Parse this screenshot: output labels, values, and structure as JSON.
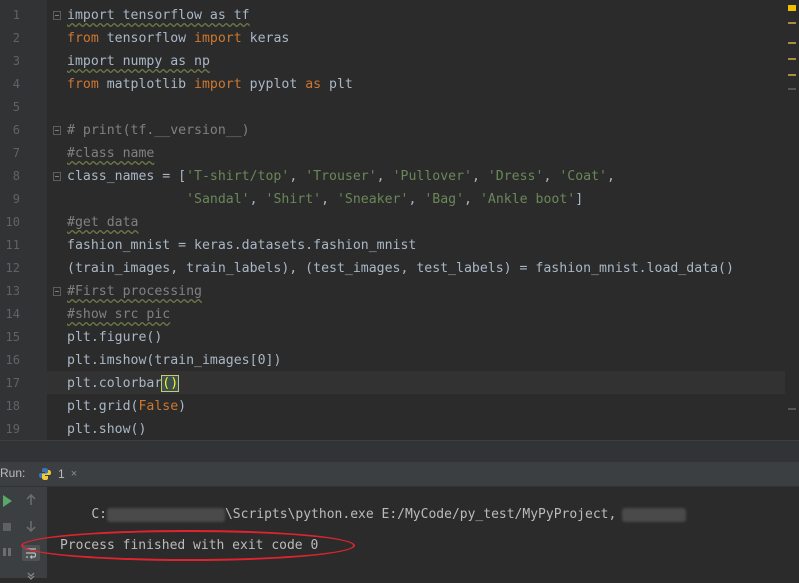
{
  "editor": {
    "line_numbers": [
      "1",
      "2",
      "3",
      "4",
      "5",
      "6",
      "7",
      "8",
      "9",
      "10",
      "11",
      "12",
      "13",
      "14",
      "15",
      "16",
      "17",
      "18",
      "19"
    ],
    "lines": [
      {
        "tokens": [
          {
            "t": "import tensorflow as tf",
            "c": "wavy"
          }
        ]
      },
      {
        "tokens": [
          {
            "t": "from",
            "c": "kw"
          },
          {
            "t": " tensorflow ",
            "c": ""
          },
          {
            "t": "import",
            "c": "kw"
          },
          {
            "t": " keras",
            "c": ""
          }
        ]
      },
      {
        "tokens": [
          {
            "t": "import numpy as np",
            "c": "wavy"
          }
        ]
      },
      {
        "tokens": [
          {
            "t": "from",
            "c": "kw"
          },
          {
            "t": " matplotlib ",
            "c": ""
          },
          {
            "t": "import",
            "c": "kw"
          },
          {
            "t": " pyplot ",
            "c": ""
          },
          {
            "t": "as",
            "c": "kw"
          },
          {
            "t": " plt",
            "c": ""
          }
        ]
      },
      {
        "tokens": []
      },
      {
        "tokens": [
          {
            "t": "# print(tf.__version__)",
            "c": "cm"
          }
        ]
      },
      {
        "tokens": [
          {
            "t": "#class name",
            "c": "cm wavy"
          }
        ]
      },
      {
        "tokens": [
          {
            "t": "class_names = [",
            "c": ""
          },
          {
            "t": "'T-shirt/top'",
            "c": "str"
          },
          {
            "t": ", ",
            "c": ""
          },
          {
            "t": "'Trouser'",
            "c": "str"
          },
          {
            "t": ", ",
            "c": ""
          },
          {
            "t": "'Pullover'",
            "c": "str"
          },
          {
            "t": ", ",
            "c": ""
          },
          {
            "t": "'Dress'",
            "c": "str"
          },
          {
            "t": ", ",
            "c": ""
          },
          {
            "t": "'Coat'",
            "c": "str"
          },
          {
            "t": ",",
            "c": ""
          }
        ]
      },
      {
        "tokens": [
          {
            "t": "               ",
            "c": ""
          },
          {
            "t": "'Sandal'",
            "c": "str"
          },
          {
            "t": ", ",
            "c": ""
          },
          {
            "t": "'Shirt'",
            "c": "str"
          },
          {
            "t": ", ",
            "c": ""
          },
          {
            "t": "'Sneaker'",
            "c": "str"
          },
          {
            "t": ", ",
            "c": ""
          },
          {
            "t": "'Bag'",
            "c": "str"
          },
          {
            "t": ", ",
            "c": ""
          },
          {
            "t": "'Ankle boot'",
            "c": "str"
          },
          {
            "t": "]",
            "c": ""
          }
        ]
      },
      {
        "tokens": [
          {
            "t": "#get data",
            "c": "cm wavy"
          }
        ]
      },
      {
        "tokens": [
          {
            "t": "fashion_mnist = keras.datasets.fashion_mnist",
            "c": ""
          }
        ]
      },
      {
        "tokens": [
          {
            "t": "(train_images, train_labels), (test_images, test_labels) = fashion_mnist.load_data()",
            "c": ""
          }
        ]
      },
      {
        "tokens": [
          {
            "t": "#First processing",
            "c": "cm wavy"
          }
        ]
      },
      {
        "tokens": [
          {
            "t": "#show src pic",
            "c": "cm wavy"
          }
        ]
      },
      {
        "tokens": [
          {
            "t": "plt.figure()",
            "c": ""
          }
        ]
      },
      {
        "tokens": [
          {
            "t": "plt.imshow(train_images[",
            "c": ""
          },
          {
            "t": "0",
            "c": ""
          },
          {
            "t": "])",
            "c": ""
          }
        ]
      },
      {
        "tokens": [
          {
            "t": "plt.colorbar",
            "c": ""
          },
          {
            "t": "()",
            "c": "paren-match"
          }
        ]
      },
      {
        "tokens": [
          {
            "t": "plt.grid(",
            "c": ""
          },
          {
            "t": "False",
            "c": "kw"
          },
          {
            "t": ")",
            "c": ""
          }
        ]
      },
      {
        "tokens": [
          {
            "t": "plt.show()",
            "c": ""
          }
        ]
      }
    ]
  },
  "run_panel": {
    "label": "Run:",
    "tab_number": "1",
    "tab_close": "×",
    "tab_icon": "python-icon"
  },
  "console": {
    "command_prefix": "C:",
    "command_middle": "\\Scripts\\python.exe E:/MyCode/py_test/MyPyProject",
    "command_comma": ",",
    "exit_message": "Process finished with exit code 0"
  },
  "colors": {
    "keyword": "#cc7832",
    "string": "#6a8759",
    "comment": "#808080",
    "text": "#a9b7c6",
    "annotation": "#e0242e"
  }
}
